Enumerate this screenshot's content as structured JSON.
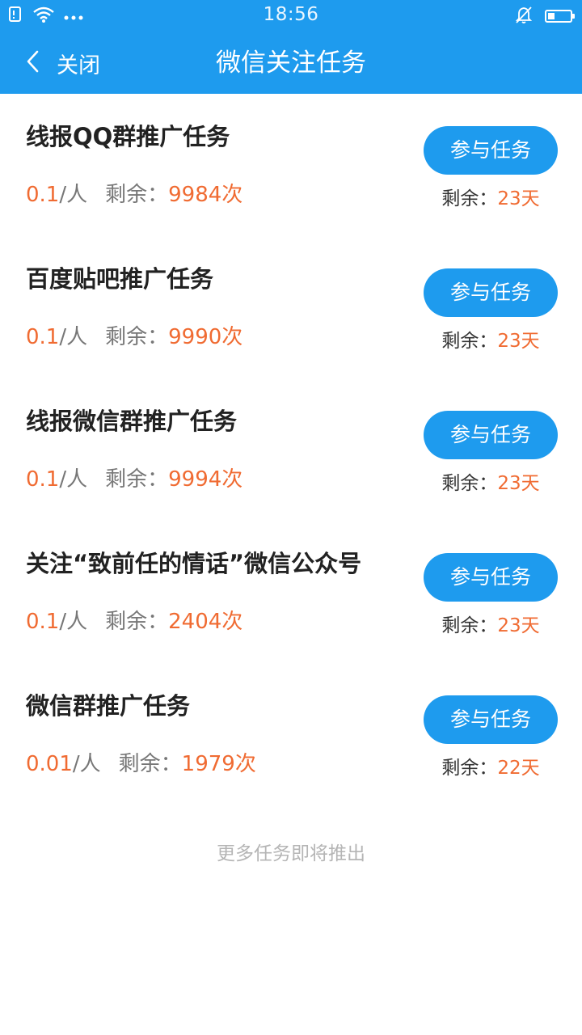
{
  "status_bar": {
    "time": "18:56",
    "battery_level": 0.3,
    "icons": [
      "sim-icon",
      "wifi-icon",
      "more-dots-icon",
      "bell-muted-icon",
      "battery-icon"
    ]
  },
  "nav": {
    "back_icon": "chevron-left-icon",
    "close_label": "关闭",
    "title": "微信关注任务"
  },
  "colors": {
    "primary": "#1e9bee",
    "accent": "#f06b32",
    "muted": "#b5b5b5"
  },
  "tasks": [
    {
      "title": "线报QQ群推广任务",
      "price": "0.1",
      "unit": "/人",
      "remain_label": "剩余：",
      "remain_count": "9984次",
      "button_label": "参与任务",
      "days_label": "剩余：",
      "days_value": "23天"
    },
    {
      "title": "百度贴吧推广任务",
      "price": "0.1",
      "unit": "/人",
      "remain_label": "剩余：",
      "remain_count": "9990次",
      "button_label": "参与任务",
      "days_label": "剩余：",
      "days_value": "23天"
    },
    {
      "title": "线报微信群推广任务",
      "price": "0.1",
      "unit": "/人",
      "remain_label": "剩余：",
      "remain_count": "9994次",
      "button_label": "参与任务",
      "days_label": "剩余：",
      "days_value": "23天"
    },
    {
      "title": "关注“致前任的情话”微信公众号",
      "price": "0.1",
      "unit": "/人",
      "remain_label": "剩余：",
      "remain_count": "2404次",
      "button_label": "参与任务",
      "days_label": "剩余：",
      "days_value": "23天"
    },
    {
      "title": "微信群推广任务",
      "price": "0.01",
      "unit": "/人",
      "remain_label": "剩余：",
      "remain_count": "1979次",
      "button_label": "参与任务",
      "days_label": "剩余：",
      "days_value": "22天"
    }
  ],
  "footer": {
    "note": "更多任务即将推出"
  }
}
